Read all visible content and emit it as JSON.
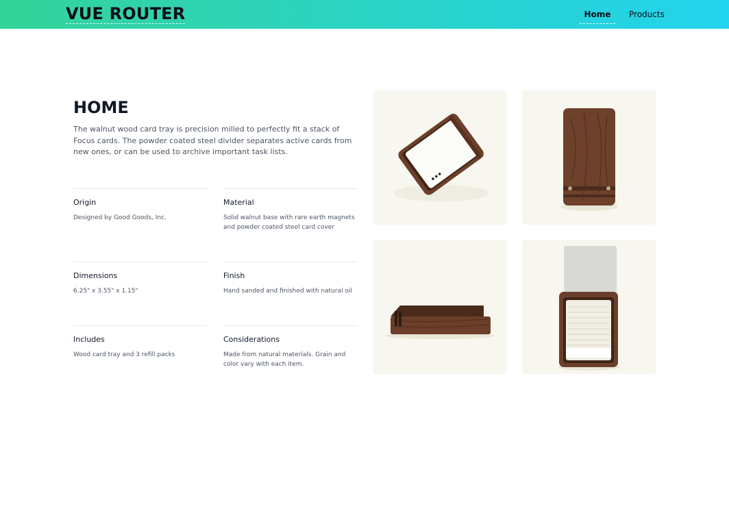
{
  "header": {
    "brand": "VUE ROUTER",
    "nav": [
      {
        "label": "Home",
        "active": true
      },
      {
        "label": "Products",
        "active": false
      }
    ],
    "gradient": [
      "#34d399",
      "#22d3ee"
    ]
  },
  "main": {
    "title": "HOME",
    "intro": "The walnut wood card tray is precision milled to perfectly fit a stack of Focus cards. The powder coated steel divider separates active cards from new ones, or can be used to archive important task lists.",
    "specs": [
      {
        "label": "Origin",
        "value": "Designed by Good Goods, Inc."
      },
      {
        "label": "Material",
        "value": "Solid walnut base with rare earth magnets and powder coated steel card cover"
      },
      {
        "label": "Dimensions",
        "value": "6.25\" x 3.55\" x 1.15\""
      },
      {
        "label": "Finish",
        "value": "Hand sanded and finished with natural oil"
      },
      {
        "label": "Includes",
        "value": "Wood card tray and 3 refill packs"
      },
      {
        "label": "Considerations",
        "value": "Made from natural materials. Grain and color vary with each item."
      }
    ],
    "images": [
      {
        "icon": "walnut-tray-angled-image"
      },
      {
        "icon": "walnut-tray-closed-image"
      },
      {
        "icon": "walnut-tray-side-image"
      },
      {
        "icon": "walnut-tray-open-image"
      }
    ]
  },
  "colors": {
    "walnut": "#6b3f2a",
    "walnut_dark": "#3f2417",
    "tile_bg": "#f8f7ef"
  }
}
